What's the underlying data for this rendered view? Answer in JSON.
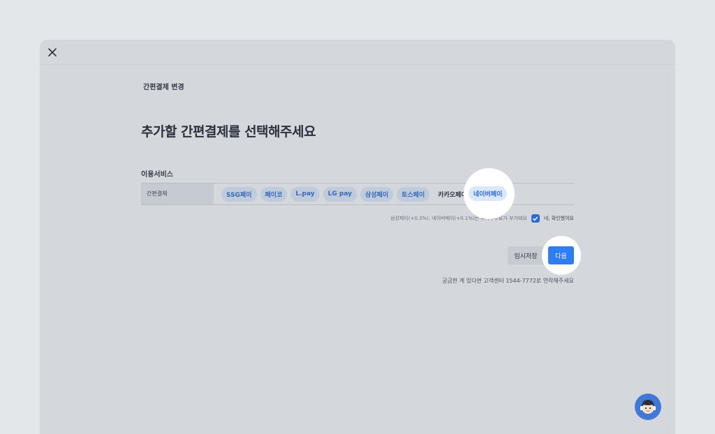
{
  "modal": {
    "breadcrumb": "간편결제 변경",
    "title": "추가할 간편결제를 선택해주세요",
    "section_label": "이용서비스",
    "row_header": "간편결제",
    "chips": [
      "SSG페이",
      "페이코",
      "L.pay",
      "LG pay",
      "삼성페이",
      "토스페이",
      "카카오페이"
    ],
    "selected_chip": "네이버페이",
    "notice": "삼성페이(+0.3%), 네이버페이(+0.1%)는 추가수수료가 부가돼요",
    "confirm_label": "네, 확인했어요",
    "confirm_checked": true,
    "save_button": "임시저장",
    "next_button": "다음",
    "help_text": "궁금한 게 있다면 고객센터 1544-7772로 연락해주세요"
  },
  "colors": {
    "accent": "#2f7df2",
    "chip_text": "#3767b8",
    "overlay_bg": "#d4d8dd"
  },
  "icons": {
    "close": "close-icon",
    "check": "check-icon",
    "support": "support-agent-icon"
  }
}
